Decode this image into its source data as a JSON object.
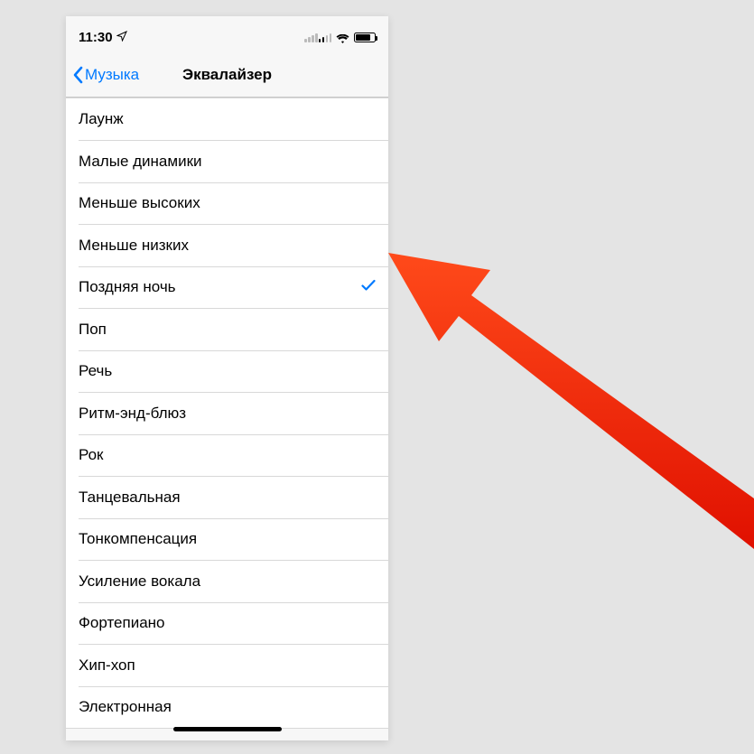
{
  "status": {
    "time": "11:30",
    "location_icon": "location-arrow",
    "wifi_icon": "wifi",
    "battery_icon": "battery",
    "signal_icon": "signal"
  },
  "nav": {
    "back_label": "Музыка",
    "title": "Эквалайзер"
  },
  "selected_index": 4,
  "items": [
    {
      "label": "Лаунж"
    },
    {
      "label": "Малые динамики"
    },
    {
      "label": "Меньше высоких"
    },
    {
      "label": "Меньше низких"
    },
    {
      "label": "Поздняя ночь"
    },
    {
      "label": "Поп"
    },
    {
      "label": "Речь"
    },
    {
      "label": "Ритм-энд-блюз"
    },
    {
      "label": "Рок"
    },
    {
      "label": "Танцевальная"
    },
    {
      "label": "Тонкомпенсация"
    },
    {
      "label": "Усиление вокала"
    },
    {
      "label": "Фортепиано"
    },
    {
      "label": "Хип-хоп"
    },
    {
      "label": "Электронная"
    }
  ],
  "colors": {
    "accent": "#007aff",
    "arrow": "#ff2e12"
  }
}
